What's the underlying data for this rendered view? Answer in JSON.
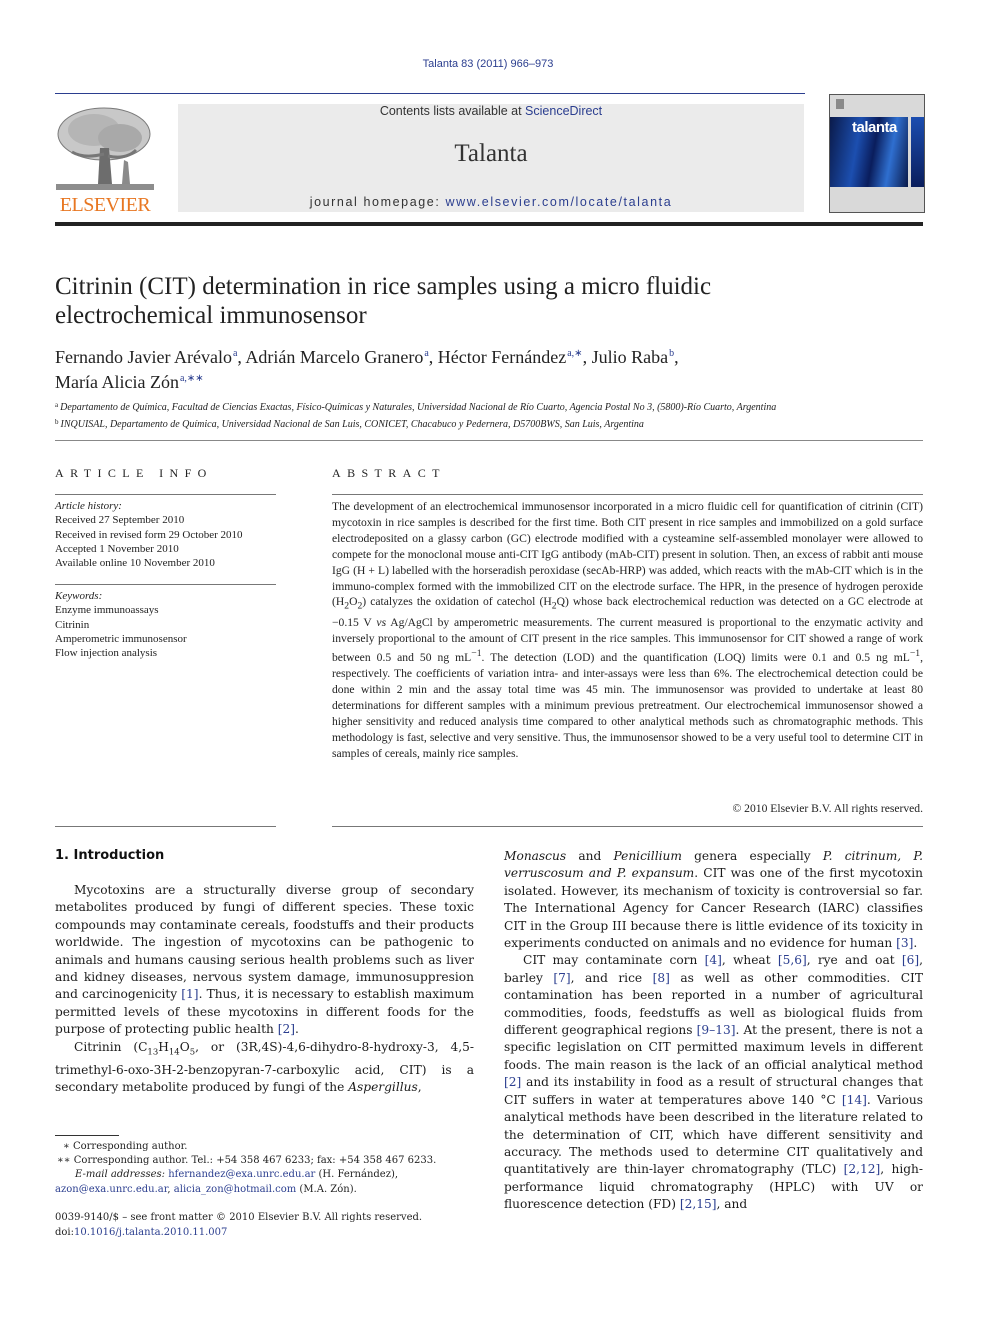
{
  "journal_ref": "Talanta 83 (2011) 966–973",
  "header": {
    "publisher": "ELSEVIER",
    "contents_prefix": "Contents lists available at ",
    "contents_link": "ScienceDirect",
    "journal_name": "Talanta",
    "homepage_prefix": "journal homepage: ",
    "homepage_link": "www.elsevier.com/locate/talanta",
    "cover_title": "talanta",
    "colors": {
      "link": "#2b3e8f",
      "publisher_orange": "#e87722",
      "header_box": "#ebebeb"
    }
  },
  "article": {
    "title_line1": "Citrinin (CIT) determination in rice samples using a micro fluidic",
    "title_line2": "electrochemical immunosensor",
    "authors": [
      {
        "name": "Fernando Javier Arévalo",
        "sup": "a"
      },
      {
        "name": "Adrián Marcelo Granero",
        "sup": "a"
      },
      {
        "name": "Héctor Fernández",
        "sup": "a,∗"
      },
      {
        "name": "Julio Raba",
        "sup": "b"
      },
      {
        "name": "María Alicia Zón",
        "sup": "a,∗∗"
      }
    ],
    "affiliations": [
      {
        "mark": "a",
        "text": "Departamento de Química, Facultad de Ciencias Exactas, Físico-Químicas y Naturales, Universidad Nacional de Río Cuarto, Agencia Postal No 3, (5800)-Río Cuarto, Argentina"
      },
      {
        "mark": "b",
        "text": "INQUISAL, Departamento de Química, Universidad Nacional de San Luis, CONICET, Chacabuco y Pedernera, D5700BWS, San Luis, Argentina"
      }
    ]
  },
  "article_info": {
    "heading": "ARTICLE INFO",
    "history_label": "Article history:",
    "history": [
      "Received 27 September 2010",
      "Received in revised form 29 October 2010",
      "Accepted 1 November 2010",
      "Available online 10 November 2010"
    ],
    "keywords_label": "Keywords:",
    "keywords": [
      "Enzyme immunoassays",
      "Citrinin",
      "Amperometric immunosensor",
      "Flow injection analysis"
    ]
  },
  "abstract": {
    "heading": "ABSTRACT",
    "p1": "The development of an electrochemical immunosensor incorporated in a micro fluidic cell for quantification of citrinin (CIT) mycotoxin in rice samples is described for the first time. Both CIT present in rice samples and immobilized on a gold surface electrodeposited on a glassy carbon (GC) electrode modified with a cysteamine self-assembled monolayer were allowed to compete for the monoclonal mouse anti-CIT IgG antibody (mAb-CIT) present in solution. Then, an excess of rabbit anti mouse IgG (H + L) labelled with the horseradish peroxidase (secAb-HRP) was added, which reacts with the mAb-CIT which is in the immuno-complex formed with the immobilized CIT on the electrode surface. The HPR, in the presence of hydrogen peroxide (",
    "h2o2_a": "H",
    "h2o2_b": "2",
    "h2o2_c": "O",
    "h2o2_d": "2",
    "p2": ") catalyzes the oxidation of catechol (",
    "h2q_a": "H",
    "h2q_b": "2",
    "h2q_c": "Q",
    "p3": ") whose back electrochemical reduction was detected on a GC electrode at −0.15 V ",
    "vs": "vs",
    "p4": " Ag/AgCl by amperometric measurements. The current measured is proportional to the enzymatic activity and inversely proportional to the amount of CIT present in the rice samples. This immunosensor for CIT showed a range of work between 0.5 and 50 ng mL",
    "unit_exp": "−1",
    "p5": ". The detection (LOD) and the quantification (LOQ) limits were 0.1 and 0.5 ng mL",
    "p6": ", respectively. The coefficients of variation intra- and inter-assays were less than 6%. The electrochemical detection could be done within 2 min and the assay total time was 45 min. The immunosensor was provided to undertake at least 80 determinations for different samples with a minimum previous pretreatment. Our electrochemical immunosensor showed a higher sensitivity and reduced analysis time compared to other analytical methods such as chromatographic methods. This methodology is fast, selective and very sensitive. Thus, the immunosensor showed to be a very useful tool to determine CIT in samples of cereals, mainly rice samples.",
    "copyright": "© 2010 Elsevier B.V. All rights reserved."
  },
  "introduction": {
    "heading": "1.  Introduction",
    "left_p1_a": "Mycotoxins are a structurally diverse group of secondary metabolites produced by fungi of different species. These toxic compounds may contaminate cereals, foodstuffs and their products worldwide. The ingestion of mycotoxins can be pathogenic to animals and humans causing serious health problems such as liver and kidney diseases, nervous system damage, immunosuppresion and carcinogenicity ",
    "cite_1": "[1]",
    "left_p1_b": ". Thus, it is necessary to establish maximum permitted levels of these mycotoxins in different foods for the purpose of protecting public health ",
    "cite_2": "[2]",
    "left_p1_c": ".",
    "left_p2_a": "Citrinin (C",
    "sub_13": "13",
    "h": "H",
    "sub_14": "14",
    "o": "O",
    "sub_5": "5",
    "left_p2_b": ", or (3R,4S)-4,6-dihydro-8-hydroxy-3, 4,5-trimethyl-6-oxo-3H-2-benzopyran-7-carboxylic acid, CIT) is a secondary metabolite produced by fungi of the ",
    "aspergillus": "Aspergillus",
    "left_p2_c": ",",
    "monascus": "Monascus",
    "and1": " and ",
    "penicillium": "Penicillium",
    "genera": " genera especially ",
    "species": "P. citrinum, P. verruscosum and P. expansum",
    "right_p1_b": ". CIT was one of the first mycotoxin isolated. However, its mechanism of toxicity is controversial so far. The International Agency for Cancer Research (IARC) classifies CIT in the Group III because there is little evidence of its toxicity in experiments conducted on animals and no evidence for human ",
    "cite_3": "[3]",
    "period": ".",
    "right_p2_a": "CIT may contaminate corn ",
    "cite_4": "[4]",
    "right_p2_b": ", wheat ",
    "cite_5_6": "[5,6]",
    "right_p2_c": ", rye and oat ",
    "cite_6": "[6]",
    "right_p2_d": ", barley ",
    "cite_7": "[7]",
    "right_p2_e": ", and rice ",
    "cite_8": "[8]",
    "right_p2_f": " as well as other commodities. CIT contamination has been reported in a number of agricultural commodities, foods, feedstuffs as well as biological fluids from different geographical regions ",
    "cite_9_13": "[9–13]",
    "right_p2_g": ". At the present, there is not a specific legislation on CIT permitted maximum levels in different foods. The main reason is the lack of an official analytical method ",
    "cite_2b": "[2]",
    "right_p2_h": " and its instability in food as a result of structural changes that CIT suffers in water at temperatures above 140 °C ",
    "cite_14": "[14]",
    "right_p2_i": ". Various analytical methods have been described in the literature related to the determination of CIT, which have different sensitivity and accuracy. The methods used to determine CIT qualitatively and quantitatively are thin-layer chromatography (TLC) ",
    "cite_2_12": "[2,12]",
    "right_p2_j": ", high-performance liquid chromatography (HPLC) with UV or fluorescence detection (FD) ",
    "cite_2_15": "[2,15]",
    "right_p2_k": ", and"
  },
  "footnotes": {
    "star1_mark": "∗",
    "star1_text": " Corresponding author.",
    "star2_mark": "∗∗",
    "star2_text": " Corresponding author. Tel.: +54 358 467 6233; fax: +54 358 467 6233.",
    "email_label": "E-mail addresses:",
    "email_1": "hfernandez@exa.unrc.edu.ar",
    "email_1_who": " (H. Fernández),",
    "email_2": "azon@exa.unrc.edu.ar",
    "sep": ", ",
    "email_3": "alicia_zon@hotmail.com",
    "email_3_who": " (M.A. Zón).",
    "front_matter": "0039-9140/$ – see front matter © 2010 Elsevier B.V. All rights reserved.",
    "doi_label": "doi:",
    "doi": "10.1016/j.talanta.2010.11.007"
  }
}
